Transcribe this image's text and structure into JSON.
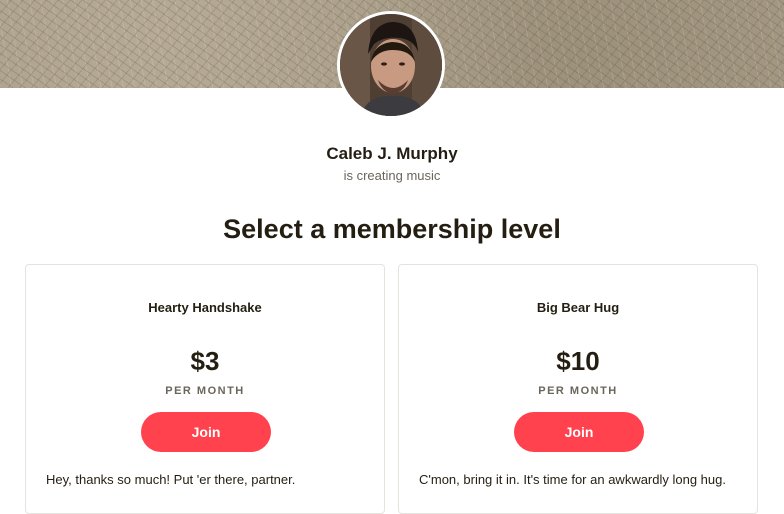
{
  "creator": {
    "name": "Caleb J. Murphy",
    "tagline": "is creating music"
  },
  "heading": "Select a membership level",
  "tiers": [
    {
      "title": "Hearty Handshake",
      "price": "$3",
      "period": "PER MONTH",
      "button_label": "Join",
      "description": "Hey, thanks so much! Put 'er there, partner."
    },
    {
      "title": "Big Bear Hug",
      "price": "$10",
      "period": "PER MONTH",
      "button_label": "Join",
      "description": "C'mon, bring it in. It's time for an awkwardly long hug."
    }
  ],
  "colors": {
    "accent": "#ff424d",
    "text": "#241e12",
    "muted": "#6b665c",
    "card_border": "#e5e3dd"
  }
}
